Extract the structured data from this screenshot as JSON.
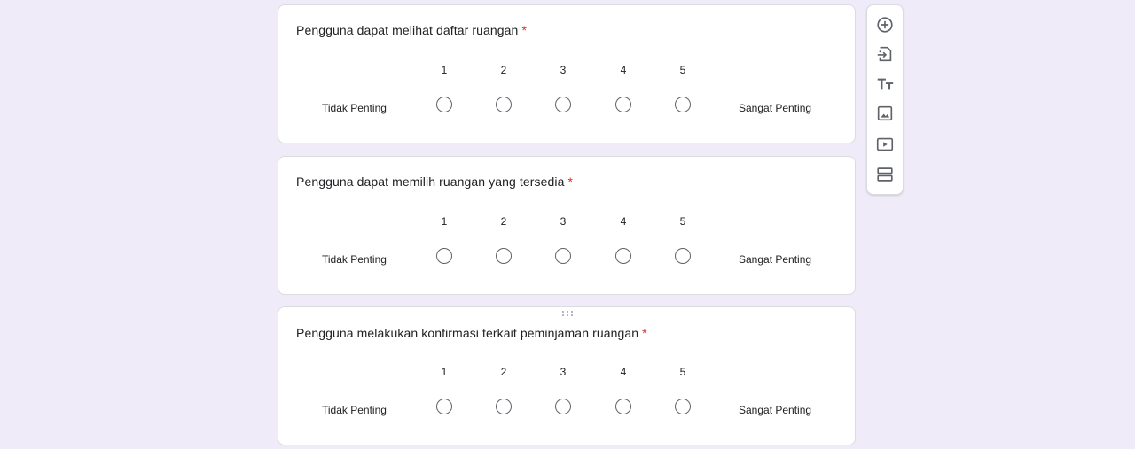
{
  "questions": [
    {
      "title": "Pengguna dapat melihat daftar ruangan",
      "required_mark": "*",
      "scale": [
        "1",
        "2",
        "3",
        "4",
        "5"
      ],
      "low_label": "Tidak Penting",
      "high_label": "Sangat Penting"
    },
    {
      "title": "Pengguna dapat memilih ruangan yang tersedia",
      "required_mark": "*",
      "scale": [
        "1",
        "2",
        "3",
        "4",
        "5"
      ],
      "low_label": "Tidak Penting",
      "high_label": "Sangat Penting"
    },
    {
      "title": "Pengguna melakukan konfirmasi terkait peminjaman ruangan",
      "required_mark": "*",
      "scale": [
        "1",
        "2",
        "3",
        "4",
        "5"
      ],
      "low_label": "Tidak Penting",
      "high_label": "Sangat Penting"
    }
  ],
  "toolbar": {
    "items": [
      {
        "icon": "add-circle-icon"
      },
      {
        "icon": "import-questions-icon"
      },
      {
        "icon": "title-text-icon"
      },
      {
        "icon": "image-icon"
      },
      {
        "icon": "video-icon"
      },
      {
        "icon": "section-icon"
      }
    ]
  },
  "colors": {
    "background": "#f0ebf8",
    "required": "#d93025",
    "icon": "#5f6368"
  }
}
